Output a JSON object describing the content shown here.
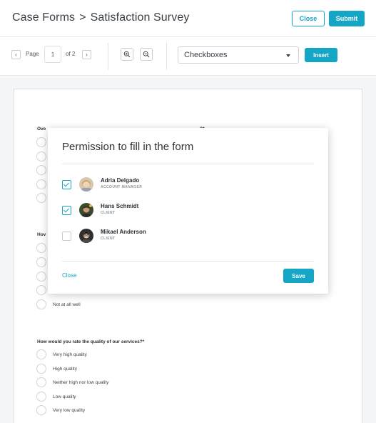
{
  "header": {
    "breadcrumb_parent": "Case Forms",
    "breadcrumb_separator": ">",
    "breadcrumb_current": "Satisfaction Survey",
    "close_label": "Close",
    "submit_label": "Submit"
  },
  "toolbar": {
    "page_label": "Page",
    "page_value": "1",
    "page_total": "of 2",
    "field_type_value": "Checkboxes",
    "insert_label": "Insert"
  },
  "form": {
    "question1_prefix": "Ove",
    "question1_partial_trail": "?*",
    "question2_prefix": "Hov",
    "question2_last_option": "Not at all well",
    "question3": {
      "text": "How would you rate the quality of our services?*",
      "options": [
        "Very high quality",
        "High quality",
        "Neither high nor low quality",
        "Low quality",
        "Very low quality"
      ]
    }
  },
  "modal": {
    "title": "Permission to fill in the form",
    "people": [
      {
        "name": "Adria Delgado",
        "role": "ACCOUNT MANAGER",
        "checked": true
      },
      {
        "name": "Hans Schmidt",
        "role": "CLIENT",
        "checked": true
      },
      {
        "name": "Mikael Anderson",
        "role": "CLIENT",
        "checked": false
      }
    ],
    "close_label": "Close",
    "save_label": "Save"
  },
  "colors": {
    "accent": "#14a6c4"
  }
}
